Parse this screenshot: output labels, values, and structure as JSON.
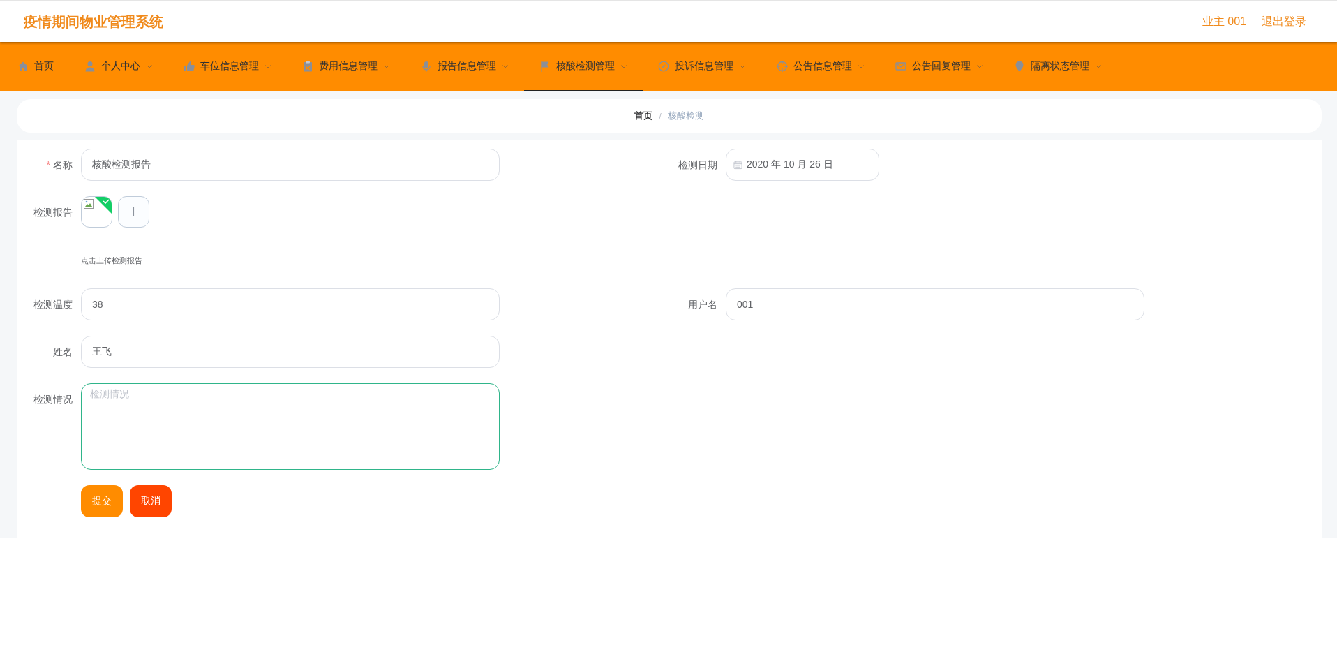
{
  "header": {
    "title": "疫情期间物业管理系统",
    "user": "业主 001",
    "logout": "退出登录"
  },
  "nav": [
    {
      "label": "首页",
      "has_submenu": false,
      "selected": false
    },
    {
      "label": "个人中心",
      "has_submenu": true,
      "selected": false
    },
    {
      "label": "车位信息管理",
      "has_submenu": true,
      "selected": false
    },
    {
      "label": "费用信息管理",
      "has_submenu": true,
      "selected": false
    },
    {
      "label": "报告信息管理",
      "has_submenu": true,
      "selected": false
    },
    {
      "label": "核酸检测管理",
      "has_submenu": true,
      "selected": true
    },
    {
      "label": "投诉信息管理",
      "has_submenu": true,
      "selected": false
    },
    {
      "label": "公告信息管理",
      "has_submenu": true,
      "selected": false
    },
    {
      "label": "公告回复管理",
      "has_submenu": true,
      "selected": false
    },
    {
      "label": "隔离状态管理",
      "has_submenu": true,
      "selected": false
    }
  ],
  "breadcrumb": {
    "separator": "/",
    "items": [
      {
        "label": "首页",
        "current": false
      },
      {
        "label": "核酸检测",
        "current": true
      }
    ]
  },
  "form": {
    "rows": [
      {
        "left": {
          "kind": "input",
          "label": "名称",
          "required_mark": "*",
          "value": "核酸检测报告"
        },
        "right": {
          "kind": "date",
          "label": "检测日期",
          "value": "2020 年 10 月 26 日"
        }
      },
      {
        "left": {
          "kind": "upload",
          "label": "检测报告",
          "files": [
            {
              "uploaded": true
            }
          ],
          "hint": "点击上传检测报告"
        }
      },
      {
        "left": {
          "kind": "input",
          "label": "检测温度",
          "value": "38"
        },
        "right": {
          "kind": "input",
          "label": "用户名",
          "value": "001"
        }
      },
      {
        "left": {
          "kind": "input",
          "label": "姓名",
          "value": "王飞"
        }
      },
      {
        "left": {
          "kind": "textarea",
          "label": "检测情况",
          "placeholder": "检测情况",
          "focused": true
        }
      }
    ],
    "buttons": [
      {
        "label": "提交",
        "kind": "primary"
      },
      {
        "label": "取消",
        "kind": "danger"
      }
    ]
  }
}
